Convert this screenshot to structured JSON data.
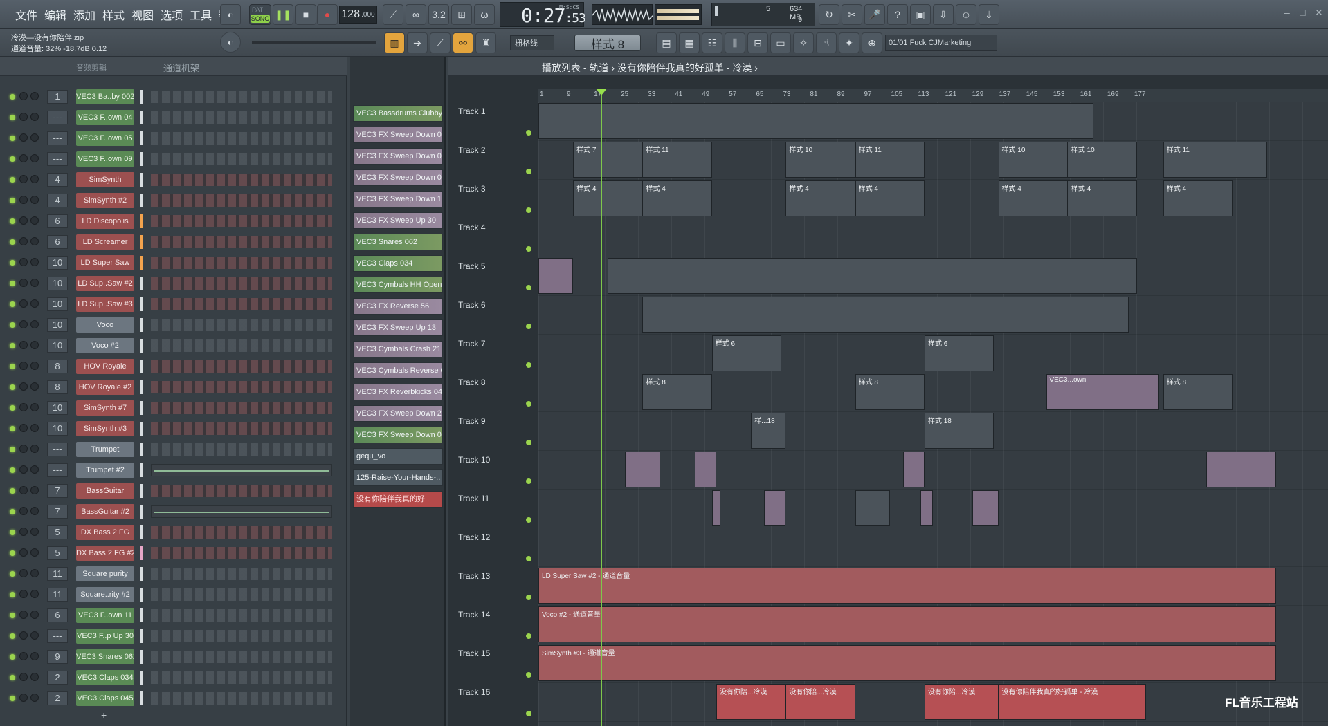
{
  "menu": [
    "文件",
    "编辑",
    "添加",
    "样式",
    "视图",
    "选项",
    "工具",
    "帮助"
  ],
  "transport": {
    "pat_label": "PAT",
    "song_label": "SONG",
    "tempo": "128",
    "tempo_decimal": ".000",
    "time": "0:27",
    "time_sub": ":53",
    "time_label": "M:S:CS"
  },
  "cpu": {
    "value": "5",
    "mem": "634 MB",
    "polyphony": "9"
  },
  "hint": {
    "file": "冷漠—没有你陪伴.zip",
    "volume": "通道音量: 32%  -18.7dB  0.12"
  },
  "snap": "栅格线",
  "pattern": "样式 8",
  "news": "01/01  Fuck CJMarketing",
  "channel_rack": {
    "title_left": "音频剪辑",
    "title": "通道机架",
    "channels": [
      {
        "num": "1",
        "name": "VEC3 Ba..by 002",
        "color": "green",
        "sel": "white"
      },
      {
        "num": "---",
        "name": "VEC3 F..own 04",
        "color": "green",
        "sel": "white"
      },
      {
        "num": "---",
        "name": "VEC3 F..own 05",
        "color": "green",
        "sel": "white"
      },
      {
        "num": "---",
        "name": "VEC3 F..own 09",
        "color": "green",
        "sel": "white"
      },
      {
        "num": "4",
        "name": "SimSynth",
        "color": "red",
        "sel": "white"
      },
      {
        "num": "4",
        "name": "SimSynth #2",
        "color": "red",
        "sel": "white"
      },
      {
        "num": "6",
        "name": "LD Discopolis",
        "color": "red",
        "sel": "orange"
      },
      {
        "num": "6",
        "name": "LD Screamer",
        "color": "red",
        "sel": "orange"
      },
      {
        "num": "10",
        "name": "LD Super Saw",
        "color": "red",
        "sel": "orange"
      },
      {
        "num": "10",
        "name": "LD Sup..Saw #2",
        "color": "red",
        "sel": "white"
      },
      {
        "num": "10",
        "name": "LD Sup..Saw #3",
        "color": "red",
        "sel": "white"
      },
      {
        "num": "10",
        "name": "Voco",
        "color": "gray",
        "sel": "white"
      },
      {
        "num": "10",
        "name": "Voco #2",
        "color": "gray",
        "sel": "white"
      },
      {
        "num": "8",
        "name": "HOV Royale",
        "color": "red",
        "sel": "white"
      },
      {
        "num": "8",
        "name": "HOV Royale #2",
        "color": "red",
        "sel": "white"
      },
      {
        "num": "10",
        "name": "SimSynth #7",
        "color": "red",
        "sel": "white"
      },
      {
        "num": "10",
        "name": "SimSynth #3",
        "color": "red",
        "sel": "white"
      },
      {
        "num": "---",
        "name": "Trumpet",
        "color": "gray",
        "sel": "white"
      },
      {
        "num": "---",
        "name": "Trumpet #2",
        "color": "gray",
        "sel": "white"
      },
      {
        "num": "7",
        "name": "BassGuitar",
        "color": "red",
        "sel": "white"
      },
      {
        "num": "7",
        "name": "BassGuitar #2",
        "color": "red",
        "sel": "white"
      },
      {
        "num": "5",
        "name": "DX Bass 2 FG",
        "color": "red",
        "sel": "white"
      },
      {
        "num": "5",
        "name": "DX Bass 2 FG #2",
        "color": "red",
        "sel": "pink"
      },
      {
        "num": "11",
        "name": "Square purity",
        "color": "gray",
        "sel": "white"
      },
      {
        "num": "11",
        "name": "Square..rity #2",
        "color": "gray",
        "sel": "white"
      },
      {
        "num": "6",
        "name": "VEC3 F..own 11",
        "color": "green",
        "sel": "white"
      },
      {
        "num": "---",
        "name": "VEC3 F..p Up 30",
        "color": "green",
        "sel": "white"
      },
      {
        "num": "9",
        "name": "VEC3 Snares 062",
        "color": "green",
        "sel": "white"
      },
      {
        "num": "2",
        "name": "VEC3 Claps 034",
        "color": "green",
        "sel": "white"
      },
      {
        "num": "2",
        "name": "VEC3 Claps 045",
        "color": "green",
        "sel": "white"
      }
    ]
  },
  "browser_items": [
    {
      "name": "VEC3 Bassdrums Clubby 0..",
      "style": "g"
    },
    {
      "name": "VEC3 FX Sweep Down 04",
      "style": "p"
    },
    {
      "name": "VEC3 FX Sweep Down 05",
      "style": "p"
    },
    {
      "name": "VEC3 FX Sweep Down 09",
      "style": "p"
    },
    {
      "name": "VEC3 FX Sweep Down 11",
      "style": "p"
    },
    {
      "name": "VEC3 FX Sweep Up 30",
      "style": "p"
    },
    {
      "name": "VEC3 Snares 062",
      "style": "g"
    },
    {
      "name": "VEC3 Claps 034",
      "style": "g"
    },
    {
      "name": "VEC3 Cymbals HH Open 0..",
      "style": "g"
    },
    {
      "name": "VEC3 FX Reverse 56",
      "style": "p"
    },
    {
      "name": "VEC3 FX Sweep Up 13",
      "style": "p"
    },
    {
      "name": "VEC3 Cymbals Crash 21",
      "style": "p"
    },
    {
      "name": "VEC3 Cymbals Reverse 06",
      "style": "p"
    },
    {
      "name": "VEC3 FX Reverbkicks 04",
      "style": "p"
    },
    {
      "name": "VEC3 FX Sweep Down 29",
      "style": "p"
    },
    {
      "name": "VEC3 FX Sweep Down 06",
      "style": "g"
    },
    {
      "name": "gequ_vo",
      "style": "s"
    },
    {
      "name": "125-Raise-Your-Hands-..",
      "style": "s"
    },
    {
      "name": "没有你陪伴我真的好..",
      "style": "sel"
    }
  ],
  "playlist": {
    "title": "播放列表 - 轨道  ›  没有你陪伴我真的好孤单 - 冷漠  ›",
    "ruler": [
      "1",
      "9",
      "17",
      "25",
      "33",
      "41",
      "49",
      "57",
      "65",
      "73",
      "81",
      "89",
      "97",
      "105",
      "113",
      "121",
      "129",
      "137",
      "145",
      "153",
      "161",
      "169",
      "177"
    ],
    "tracks": [
      "Track 1",
      "Track 2",
      "Track 3",
      "Track 4",
      "Track 5",
      "Track 6",
      "Track 7",
      "Track 8",
      "Track 9",
      "Track 10",
      "Track 11",
      "Track 12",
      "Track 13",
      "Track 14",
      "Track 15",
      "Track 16"
    ],
    "clips": [
      {
        "track": 1,
        "start": 1,
        "end": 129,
        "type": "pat",
        "label": ""
      },
      {
        "track": 2,
        "start": 9,
        "end": 25,
        "type": "pat",
        "label": "样式 7"
      },
      {
        "track": 2,
        "start": 25,
        "end": 41,
        "type": "pat",
        "label": "样式 11"
      },
      {
        "track": 2,
        "start": 58,
        "end": 74,
        "type": "pat",
        "label": "样式 10"
      },
      {
        "track": 2,
        "start": 74,
        "end": 90,
        "type": "pat",
        "label": "样式 11"
      },
      {
        "track": 2,
        "start": 107,
        "end": 123,
        "type": "pat",
        "label": "样式 10"
      },
      {
        "track": 2,
        "start": 123,
        "end": 139,
        "type": "pat",
        "label": "样式 10"
      },
      {
        "track": 2,
        "start": 145,
        "end": 169,
        "type": "pat",
        "label": "样式 11"
      },
      {
        "track": 3,
        "start": 9,
        "end": 25,
        "type": "pat",
        "label": "样式 4"
      },
      {
        "track": 3,
        "start": 25,
        "end": 41,
        "type": "pat",
        "label": "样式 4"
      },
      {
        "track": 3,
        "start": 58,
        "end": 74,
        "type": "pat",
        "label": "样式 4"
      },
      {
        "track": 3,
        "start": 74,
        "end": 90,
        "type": "pat",
        "label": "样式 4"
      },
      {
        "track": 3,
        "start": 107,
        "end": 123,
        "type": "pat",
        "label": "样式 4"
      },
      {
        "track": 3,
        "start": 123,
        "end": 139,
        "type": "pat",
        "label": "样式 4"
      },
      {
        "track": 3,
        "start": 145,
        "end": 161,
        "type": "pat",
        "label": "样式 4"
      },
      {
        "track": 5,
        "start": 1,
        "end": 9,
        "type": "aud",
        "label": ""
      },
      {
        "track": 5,
        "start": 17,
        "end": 139,
        "type": "pat",
        "label": ""
      },
      {
        "track": 6,
        "start": 25,
        "end": 137,
        "type": "pat",
        "label": ""
      },
      {
        "track": 7,
        "start": 41,
        "end": 57,
        "type": "pat",
        "label": "样式 6"
      },
      {
        "track": 7,
        "start": 90,
        "end": 106,
        "type": "pat",
        "label": "样式 6"
      },
      {
        "track": 8,
        "start": 25,
        "end": 41,
        "type": "pat",
        "label": "样式 8"
      },
      {
        "track": 8,
        "start": 74,
        "end": 90,
        "type": "pat",
        "label": "样式 8"
      },
      {
        "track": 8,
        "start": 118,
        "end": 144,
        "type": "aud",
        "label": "VEC3...own"
      },
      {
        "track": 8,
        "start": 145,
        "end": 161,
        "type": "pat",
        "label": "样式 8"
      },
      {
        "track": 9,
        "start": 50,
        "end": 58,
        "type": "pat",
        "label": "样...18"
      },
      {
        "track": 9,
        "start": 90,
        "end": 106,
        "type": "pat",
        "label": "样式 18"
      },
      {
        "track": 10,
        "start": 21,
        "end": 29,
        "type": "aud",
        "label": ""
      },
      {
        "track": 10,
        "start": 37,
        "end": 42,
        "type": "aud",
        "label": ""
      },
      {
        "track": 10,
        "start": 85,
        "end": 90,
        "type": "aud",
        "label": ""
      },
      {
        "track": 10,
        "start": 155,
        "end": 171,
        "type": "aud",
        "label": ""
      },
      {
        "track": 11,
        "start": 41,
        "end": 43,
        "type": "aud",
        "label": ""
      },
      {
        "track": 11,
        "start": 53,
        "end": 58,
        "type": "aud",
        "label": ""
      },
      {
        "track": 11,
        "start": 74,
        "end": 82,
        "type": "pat",
        "label": ""
      },
      {
        "track": 11,
        "start": 89,
        "end": 92,
        "type": "aud",
        "label": ""
      },
      {
        "track": 11,
        "start": 101,
        "end": 107,
        "type": "aud",
        "label": ""
      },
      {
        "track": 13,
        "start": 1,
        "end": 171,
        "type": "auto",
        "label": "LD Super Saw #2 - 通道音量"
      },
      {
        "track": 14,
        "start": 1,
        "end": 171,
        "type": "auto",
        "label": "Voco #2 - 通道音量"
      },
      {
        "track": 15,
        "start": 1,
        "end": 171,
        "type": "auto",
        "label": "SimSynth #3 - 通道音量"
      },
      {
        "track": 16,
        "start": 42,
        "end": 58,
        "type": "song",
        "label": "没有你陪...冷漠"
      },
      {
        "track": 16,
        "start": 58,
        "end": 74,
        "type": "song",
        "label": "没有你陪...冷漠"
      },
      {
        "track": 16,
        "start": 90,
        "end": 107,
        "type": "song",
        "label": "没有你陪...冷漠"
      },
      {
        "track": 16,
        "start": 107,
        "end": 141,
        "type": "song",
        "label": "没有你陪伴我真的好孤单 - 冷漠"
      }
    ]
  },
  "watermark": "FL音乐工程站",
  "colors": {
    "accent": "#8fd14a",
    "playhead": "#7ec84b"
  }
}
